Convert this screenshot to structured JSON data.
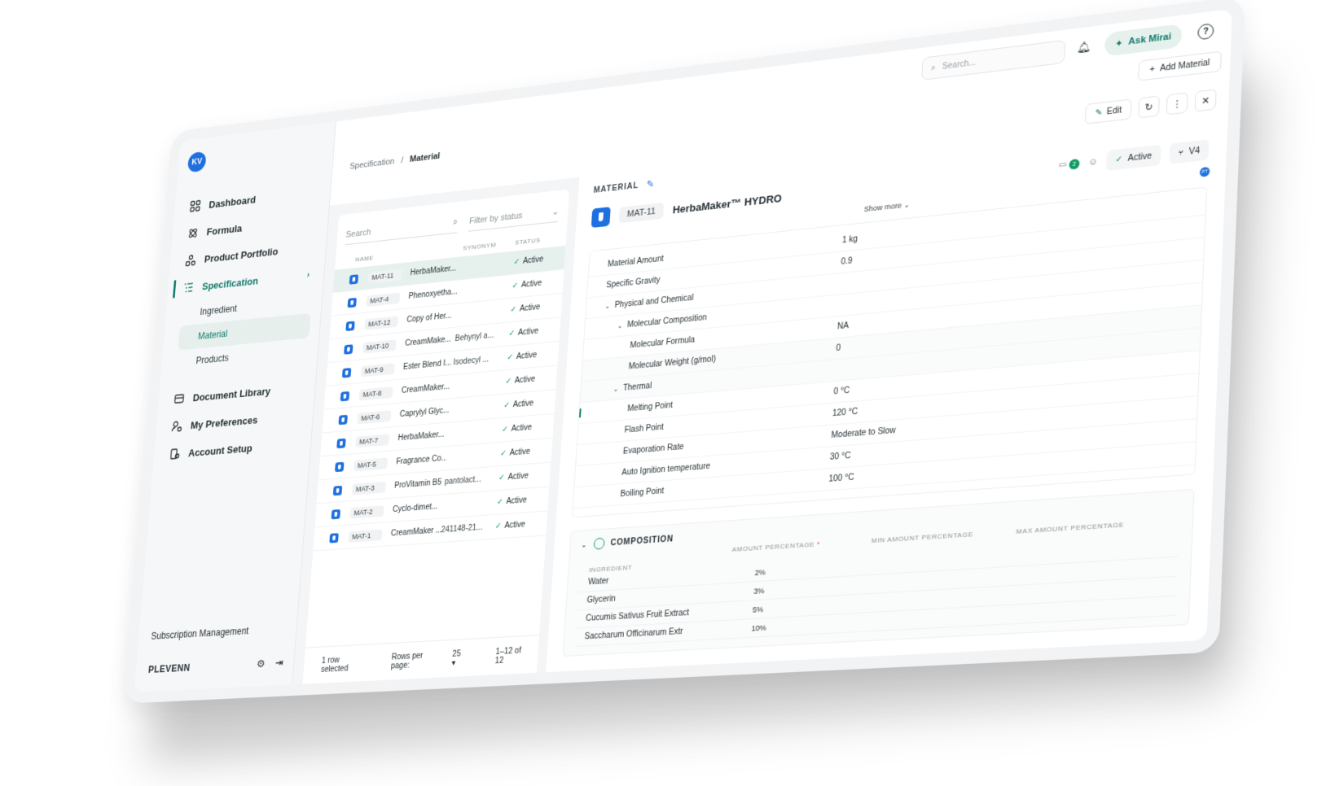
{
  "sidebar": {
    "avatar_initials": "KV",
    "items": [
      {
        "label": "Dashboard",
        "icon": "dashboard-icon"
      },
      {
        "label": "Formula",
        "icon": "formula-icon"
      },
      {
        "label": "Product Portfolio",
        "icon": "portfolio-icon"
      },
      {
        "label": "Specification",
        "icon": "specification-icon"
      }
    ],
    "sub_items": [
      "Ingredient",
      "Material",
      "Products"
    ],
    "items_lower": [
      {
        "label": "Document Library",
        "icon": "library-icon"
      },
      {
        "label": "My Preferences",
        "icon": "preferences-icon"
      },
      {
        "label": "Account Setup",
        "icon": "account-icon"
      }
    ],
    "subscription_label": "Subscription Management",
    "org_name": "PLEVENN"
  },
  "topbar": {
    "search_placeholder": "Search...",
    "ask_label": "Ask Mirai",
    "add_material_label": "Add Material",
    "help_glyph": "?"
  },
  "breadcrumb": {
    "parent": "Specification",
    "separator": "/",
    "current": "Material"
  },
  "actions": {
    "edit_label": "Edit"
  },
  "list": {
    "search_placeholder": "Search",
    "filter_placeholder": "Filter by status",
    "columns": {
      "name": "NAME",
      "synonym": "SYNONYM",
      "status": "STATUS"
    },
    "rows": [
      {
        "code": "MAT-11",
        "name": "HerbaMaker...",
        "synonym": "",
        "status": "Active"
      },
      {
        "code": "MAT-4",
        "name": "Phenoxyetha...",
        "synonym": "",
        "status": "Active"
      },
      {
        "code": "MAT-12",
        "name": "Copy of Her...",
        "synonym": "",
        "status": "Active"
      },
      {
        "code": "MAT-10",
        "name": "CreamMake...",
        "synonym": "Behynyl a...",
        "status": "Active"
      },
      {
        "code": "MAT-9",
        "name": "Ester Blend I...",
        "synonym": "Isodecyl ...",
        "status": "Active"
      },
      {
        "code": "MAT-8",
        "name": "CreamMaker...",
        "synonym": "",
        "status": "Active"
      },
      {
        "code": "MAT-6",
        "name": "Caprylyl Glyc...",
        "synonym": "",
        "status": "Active"
      },
      {
        "code": "MAT-7",
        "name": "HerbaMaker...",
        "synonym": "",
        "status": "Active"
      },
      {
        "code": "MAT-5",
        "name": "Fragrance Co...",
        "synonym": "",
        "status": "Active"
      },
      {
        "code": "MAT-3",
        "name": "ProVitamin B5",
        "synonym": "pantolact...",
        "status": "Active"
      },
      {
        "code": "MAT-2",
        "name": "Cyclo-dimet...",
        "synonym": "",
        "status": "Active"
      },
      {
        "code": "MAT-1",
        "name": "CreamMaker ...",
        "synonym": "241148-21...",
        "status": "Active"
      }
    ],
    "footer": {
      "selected": "1 row selected",
      "rows_per_page_label": "Rows per page:",
      "rows_per_page_value": "25",
      "range": "1–12 of 12"
    }
  },
  "detail": {
    "section_label": "MATERIAL",
    "code": "MAT-11",
    "name": "HerbaMaker™ HYDRO",
    "comment_count": "2",
    "status": "Active",
    "version": "V4",
    "pt_badge": "PT",
    "show_more": "Show more",
    "properties": [
      {
        "label": "Material Amount",
        "value": "1 kg",
        "level": 0
      },
      {
        "label": "Specific Gravity",
        "value": "0.9",
        "level": 0
      },
      {
        "label": "Physical and Chemical",
        "value": "",
        "level": 0,
        "group": true
      },
      {
        "label": "Molecular Composition",
        "value": "",
        "level": 1,
        "group": true
      },
      {
        "label": "Molecular Formula",
        "value": "NA",
        "level": 2
      },
      {
        "label": "Molecular Weight (g/mol)",
        "value": "0",
        "level": 2
      },
      {
        "label": "Thermal",
        "value": "",
        "level": 1,
        "group": true
      },
      {
        "label": "Melting Point",
        "value": "0 °C",
        "level": 2
      },
      {
        "label": "Flash Point",
        "value": "120 °C",
        "level": 2
      },
      {
        "label": "Evaporation Rate",
        "value": "Moderate to Slow",
        "level": 2
      },
      {
        "label": "Auto Ignition temperature",
        "value": "30 °C",
        "level": 2
      },
      {
        "label": "Boiling Point",
        "value": "100 °C",
        "level": 2
      }
    ],
    "composition": {
      "title": "COMPOSITION",
      "columns": {
        "ingredient": "INGREDIENT",
        "amount": "AMOUNT PERCENTAGE",
        "min": "MIN AMOUNT PERCENTAGE",
        "max": "MAX AMOUNT PERCENTAGE"
      },
      "rows": [
        {
          "ingredient": "Water",
          "amount": "2%"
        },
        {
          "ingredient": "Glycerin",
          "amount": "3%"
        },
        {
          "ingredient": "Cucumis Sativus Fruit Extract",
          "amount": "5%"
        },
        {
          "ingredient": "Saccharum Officinarum Extr",
          "amount": "10%"
        }
      ]
    }
  },
  "colors": {
    "accent": "#0f7a6c",
    "brand_blue": "#1e6fe0",
    "success": "#0f9a60"
  }
}
